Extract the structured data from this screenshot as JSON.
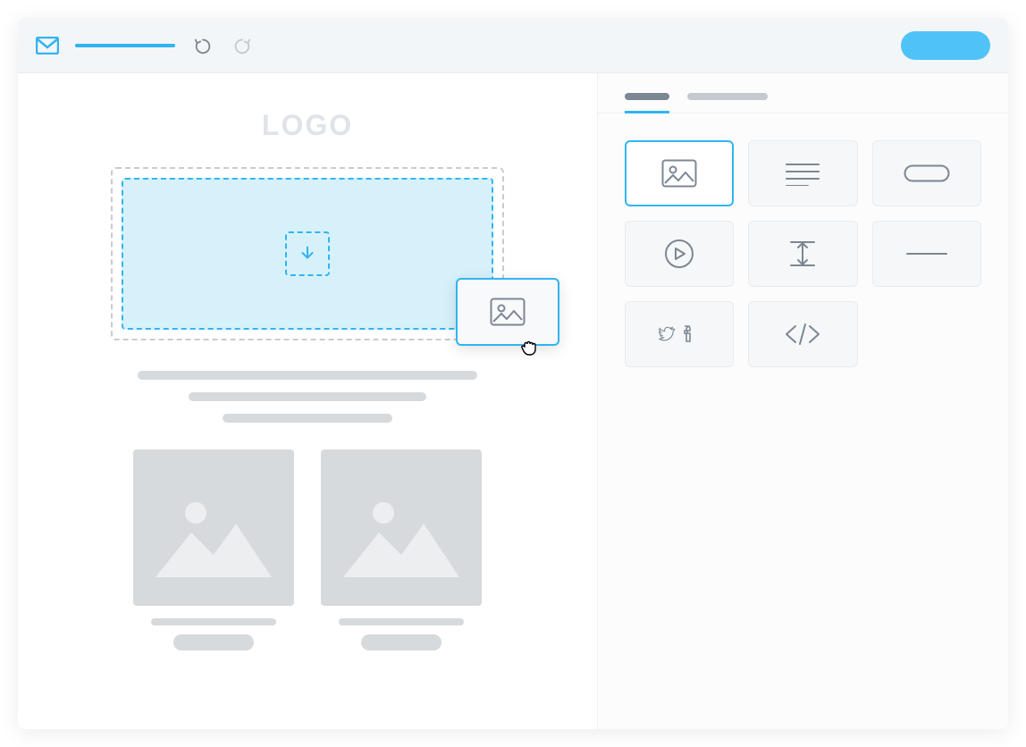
{
  "toolbar": {
    "mail_icon": "mail",
    "undo_label": "undo",
    "redo_label": "redo",
    "primary_action": "primary"
  },
  "canvas": {
    "logo_text": "LOGO",
    "dropzone": {
      "hint_icon": "arrow-down"
    },
    "dragging_block": {
      "type": "image"
    }
  },
  "sidebar": {
    "tabs": [
      {
        "active": true
      },
      {
        "active": false
      }
    ],
    "blocks": [
      {
        "name": "image",
        "selected": true
      },
      {
        "name": "text",
        "selected": false
      },
      {
        "name": "button",
        "selected": false
      },
      {
        "name": "video",
        "selected": false
      },
      {
        "name": "spacer",
        "selected": false
      },
      {
        "name": "divider",
        "selected": false
      },
      {
        "name": "social",
        "selected": false
      },
      {
        "name": "html",
        "selected": false
      }
    ]
  }
}
